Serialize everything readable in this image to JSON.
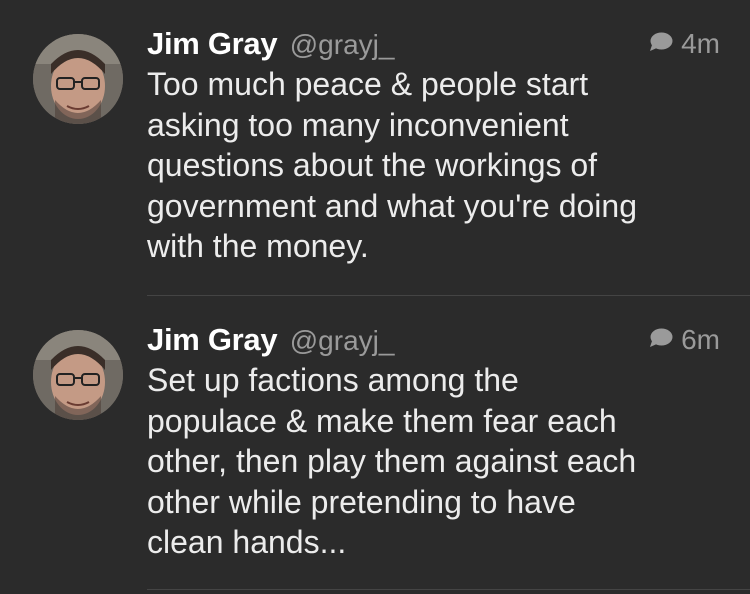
{
  "tweets": [
    {
      "author_name": "Jim Gray",
      "handle": "@grayj_",
      "time": "4m",
      "reply_icon": "speech-bubble-icon",
      "lines": [
        "Too much peace & people start",
        "asking too many inconvenient",
        "questions about the workings of",
        "government and what you're doing",
        "with the money."
      ]
    },
    {
      "author_name": "Jim Gray",
      "handle": "@grayj_",
      "time": "6m",
      "reply_icon": "speech-bubble-icon",
      "lines": [
        "Set up factions among the",
        "populace & make them fear each",
        "other, then play them against each",
        "other while pretending to have",
        "clean hands..."
      ]
    }
  ],
  "colors": {
    "background": "#2b2b2b",
    "name": "#ffffff",
    "secondary": "#9a9a9a",
    "divider": "#444444"
  }
}
